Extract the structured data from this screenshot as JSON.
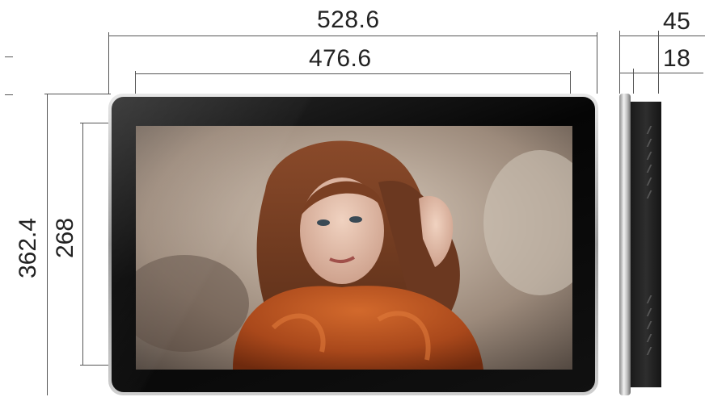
{
  "dimensions": {
    "overall_width": "528.6",
    "screen_width": "476.6",
    "overall_height": "362.4",
    "screen_height": "268",
    "total_depth": "45",
    "bezel_depth": "18"
  },
  "views": [
    "front-view",
    "side-view"
  ],
  "colors": {
    "frame": "#c8c8c8",
    "bezel": "#0b0b0b",
    "dimension_line": "#555555"
  }
}
